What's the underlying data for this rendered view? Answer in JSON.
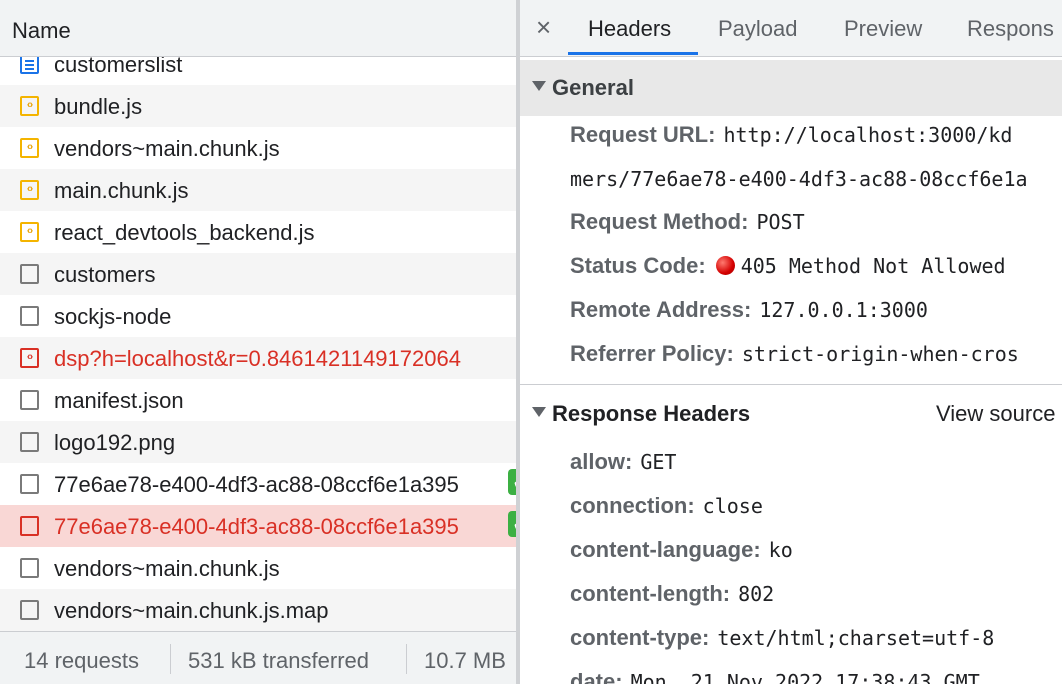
{
  "network": {
    "column_header": "Name",
    "requests": [
      {
        "name": "customerslist",
        "icon": "document-icon"
      },
      {
        "name": "bundle.js",
        "icon": "script-icon"
      },
      {
        "name": "vendors~main.chunk.js",
        "icon": "script-icon"
      },
      {
        "name": "main.chunk.js",
        "icon": "script-icon"
      },
      {
        "name": "react_devtools_backend.js",
        "icon": "script-icon"
      },
      {
        "name": "customers",
        "icon": "file-icon"
      },
      {
        "name": "sockjs-node",
        "icon": "file-icon"
      },
      {
        "name": "dsp?h=localhost&r=0.8461421149172064",
        "icon": "script-icon",
        "error": true
      },
      {
        "name": "manifest.json",
        "icon": "file-icon"
      },
      {
        "name": "logo192.png",
        "icon": "file-icon"
      },
      {
        "name": "77e6ae78-e400-4df3-ac88-08ccf6e1a395",
        "icon": "file-icon"
      },
      {
        "name": "77e6ae78-e400-4df3-ac88-08ccf6e1a395",
        "icon": "file-icon",
        "error": true,
        "selected": true
      },
      {
        "name": "vendors~main.chunk.js",
        "icon": "file-icon"
      },
      {
        "name": "vendors~main.chunk.js.map",
        "icon": "file-icon"
      }
    ],
    "status": {
      "requests": "14 requests",
      "transferred": "531 kB transferred",
      "resources": "10.7 MB"
    }
  },
  "details": {
    "close_label": "×",
    "tabs": [
      "Headers",
      "Payload",
      "Preview",
      "Respons"
    ],
    "active_tab": "Headers",
    "general": {
      "title": "General",
      "request_url_key": "Request URL:",
      "request_url_line1": "http://localhost:3000/kd",
      "request_url_line2": "mers/77e6ae78-e400-4df3-ac88-08ccf6e1a",
      "request_method_key": "Request Method:",
      "request_method": "POST",
      "status_code_key": "Status Code:",
      "status_code": "405 Method Not Allowed",
      "remote_address_key": "Remote Address:",
      "remote_address": "127.0.0.1:3000",
      "referrer_policy_key": "Referrer Policy:",
      "referrer_policy": "strict-origin-when-cros"
    },
    "response_headers": {
      "title": "Response Headers",
      "view_source": "View source",
      "items": [
        {
          "key": "allow:",
          "value": "GET"
        },
        {
          "key": "connection:",
          "value": "close"
        },
        {
          "key": "content-language:",
          "value": "ko"
        },
        {
          "key": "content-length:",
          "value": "802"
        },
        {
          "key": "content-type:",
          "value": "text/html;charset=utf-8"
        },
        {
          "key": "date:",
          "value": "Mon, 21 Nov 2022 17:38:43 GMT"
        }
      ]
    }
  },
  "colors": {
    "error_red": "#d93025",
    "accent_blue": "#1a73e8",
    "selected_row": "#f9d7d5",
    "check_green": "#3cb043"
  }
}
